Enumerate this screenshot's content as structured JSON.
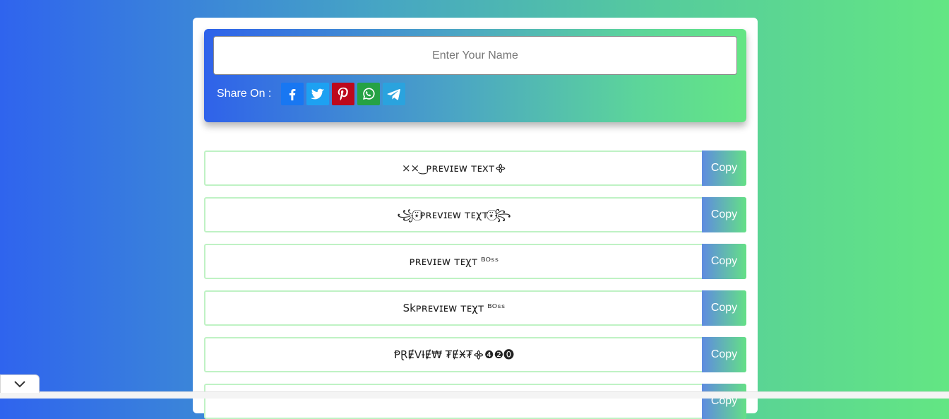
{
  "header": {
    "name_placeholder": "Enter Your Name",
    "share_label": "Share On :",
    "share_buttons": [
      {
        "icon": "facebook-icon",
        "color": "#1877f2"
      },
      {
        "icon": "twitter-icon",
        "color": "#1da1f2"
      },
      {
        "icon": "pinterest-icon",
        "color": "#bd081c"
      },
      {
        "icon": "whatsapp-icon",
        "color": "#25a244"
      },
      {
        "icon": "telegram-icon",
        "color": "#2aa3de"
      }
    ]
  },
  "rows": [
    {
      "text": "×× ͜   ᴘʀᴇᴠɪᴇᴡ ᴛᴇxᴛ᯽",
      "copy": "Copy"
    },
    {
      "text": "꧁⍣⃝ᴘʀᴇᴠɪᴇᴡ ᴛᴇχᴛ⍣⃝꧂",
      "copy": "Copy"
    },
    {
      "text": "ᴘʀᴇᴠɪᴇᴡ ᴛᴇχᴛ ᴮᴼˢˢ",
      "copy": "Copy"
    },
    {
      "text": "Skᴘʀᴇᴠɪᴇᴡ ᴛᴇχᴛ ᴮᴼˢˢ",
      "copy": "Copy"
    },
    {
      "text": "ⱣⱤɆVƗɆ₩ ₮ɆӾ₮᯽❹❷⓿",
      "copy": "Copy"
    },
    {
      "text": "",
      "copy": "Copy"
    }
  ],
  "colors": {
    "accent_green": "#64e584",
    "accent_blue": "#2f62ea"
  }
}
